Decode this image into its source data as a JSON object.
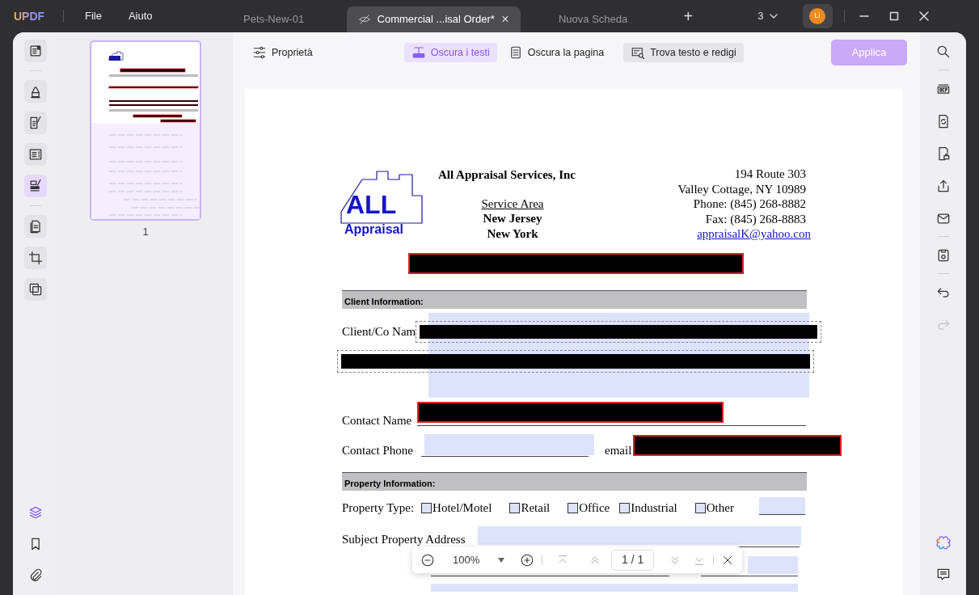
{
  "app": {
    "logo": "UPDF",
    "menus": [
      "File",
      "Aiuto"
    ]
  },
  "tabs": [
    {
      "label": "Pets-New-01",
      "selected": false
    },
    {
      "label": "Commercial ...isal Order*",
      "selected": true
    },
    {
      "label": "Nuova Scheda",
      "selected": false
    }
  ],
  "tab_close": "×",
  "new_tab": "+",
  "window_count": "3",
  "avatar": "Li",
  "left_rail": [
    {
      "selected": false
    },
    {
      "selected": false
    },
    {
      "selected": false
    },
    {
      "selected": false
    },
    {
      "selected": true
    },
    {
      "selected": false
    },
    {
      "selected": false
    },
    {
      "selected": false
    }
  ],
  "left_rail_bottom": [
    {
      "selected": true
    },
    {
      "selected": false
    },
    {
      "selected": false
    }
  ],
  "thumbnail": {
    "label": "1",
    "selected": true
  },
  "toolbar": [
    {
      "label": "Proprietà",
      "selected": false
    },
    {
      "label": "Oscura i testi",
      "selected": true
    },
    {
      "label": "Oscura la pagina",
      "selected": false
    },
    {
      "label": "Trova testo e redigi",
      "selected": false
    }
  ],
  "apply_button": {
    "label": "Applica",
    "disabled": true
  },
  "page": {
    "logo": {
      "big": "ALL",
      "small": "Appraisal"
    },
    "company": "All Appraisal Services, Inc",
    "service_area": "Service Area",
    "areas": [
      "New Jersey",
      "New York"
    ],
    "address": [
      "194 Route 303",
      "Valley Cottage, NY 10989",
      "Phone:  (845) 268-8882",
      "Fax:  (845) 268-8883"
    ],
    "email": "appraisalK@yahoo.con",
    "sections": [
      "Client Information:",
      "Property Information:"
    ],
    "labels": [
      "Client/Co Nam",
      "Contact Name",
      "Contact Phone",
      "email",
      "Subject Property Address"
    ],
    "property_type": {
      "label": "Property Type:",
      "options": [
        {
          "label": "Hotel/Motel",
          "checked": false
        },
        {
          "label": "Retail",
          "checked": false
        },
        {
          "label": "Office",
          "checked": false
        },
        {
          "label": "Industrial",
          "checked": false
        },
        {
          "label": "Other",
          "checked": false
        }
      ]
    },
    "redactions": [
      {
        "selected": false
      },
      {
        "selected": true
      },
      {
        "selected": true
      },
      {
        "selected": false
      },
      {
        "selected": false
      }
    ]
  },
  "zoom_bar": {
    "zoom": "100%",
    "page": "1 / 1"
  },
  "right_rail": [
    {
      "disabled": false
    },
    {
      "disabled": false
    },
    {
      "disabled": false
    },
    {
      "disabled": false
    },
    {
      "disabled": false
    },
    {
      "disabled": false
    },
    {
      "disabled": false
    },
    {
      "disabled": false
    },
    {
      "disabled": true
    }
  ],
  "right_rail_bottom": [
    {
      "disabled": false
    },
    {
      "disabled": false
    }
  ]
}
